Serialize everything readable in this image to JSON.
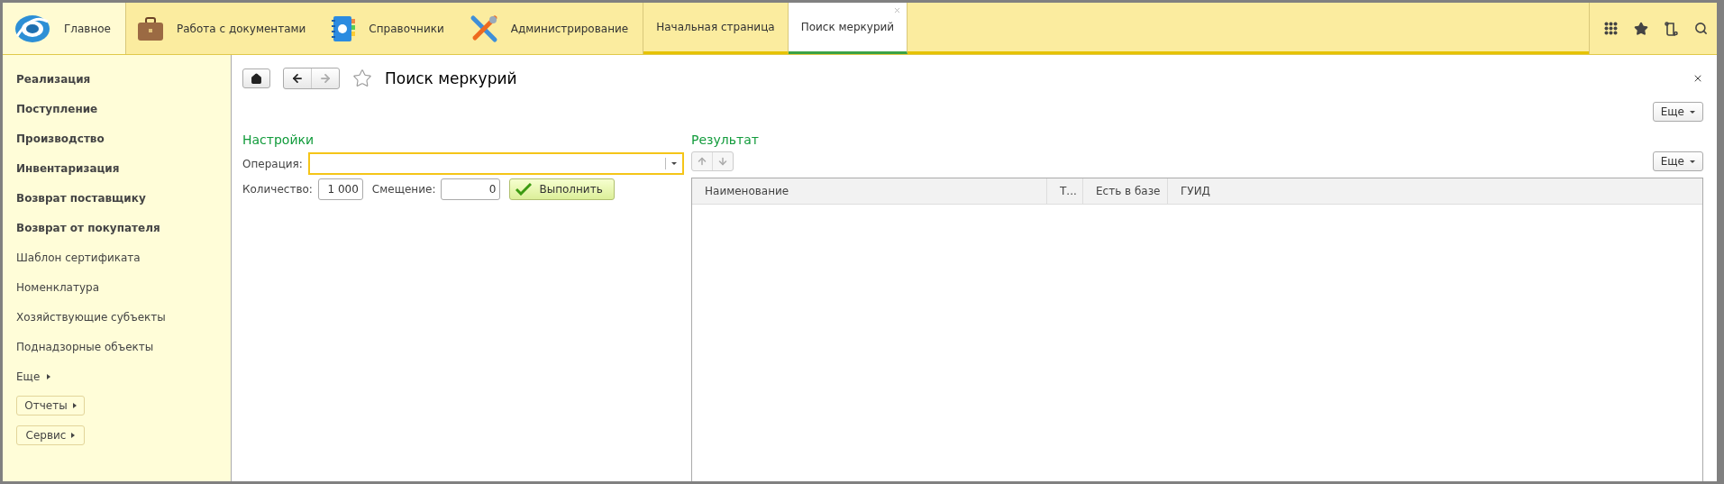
{
  "sections": [
    {
      "label": "Главное",
      "selected": true
    },
    {
      "label": "Работа с документами",
      "selected": false
    },
    {
      "label": "Справочники",
      "selected": false
    },
    {
      "label": "Администрирование",
      "selected": false
    }
  ],
  "open_tabs": [
    {
      "label": "Начальная страница",
      "selected": false
    },
    {
      "label": "Поиск меркурий",
      "selected": true
    }
  ],
  "sidebar": {
    "items": [
      {
        "label": "Реализация",
        "kind": "important"
      },
      {
        "label": "Поступление",
        "kind": "important"
      },
      {
        "label": "Производство",
        "kind": "important"
      },
      {
        "label": "Инвентаризация",
        "kind": "important"
      },
      {
        "label": "Возврат поставщику",
        "kind": "important"
      },
      {
        "label": "Возврат от покупателя",
        "kind": "important"
      },
      {
        "label": "Шаблон сертификата",
        "kind": "plain"
      },
      {
        "label": "Номенклатура",
        "kind": "plain"
      },
      {
        "label": "Хозяйствующие субъекты",
        "kind": "plain"
      },
      {
        "label": "Поднадзорные объекты",
        "kind": "plain"
      },
      {
        "label": "Еще",
        "kind": "submenu"
      }
    ],
    "buttons": [
      "Отчеты",
      "Сервис"
    ]
  },
  "form": {
    "title": "Поиск меркурий",
    "more_button": "Еще",
    "settings": {
      "heading": "Настройки",
      "operation_label": "Операция:",
      "quantity_label": "Количество:",
      "quantity_value": "1 000",
      "offset_label": "Смещение:",
      "offset_value": "0",
      "run_button": "Выполнить"
    },
    "result": {
      "heading": "Результат",
      "more_button": "Еще",
      "columns": [
        "Наименование",
        "Т...",
        "Есть в базе",
        "ГУИД"
      ]
    }
  }
}
